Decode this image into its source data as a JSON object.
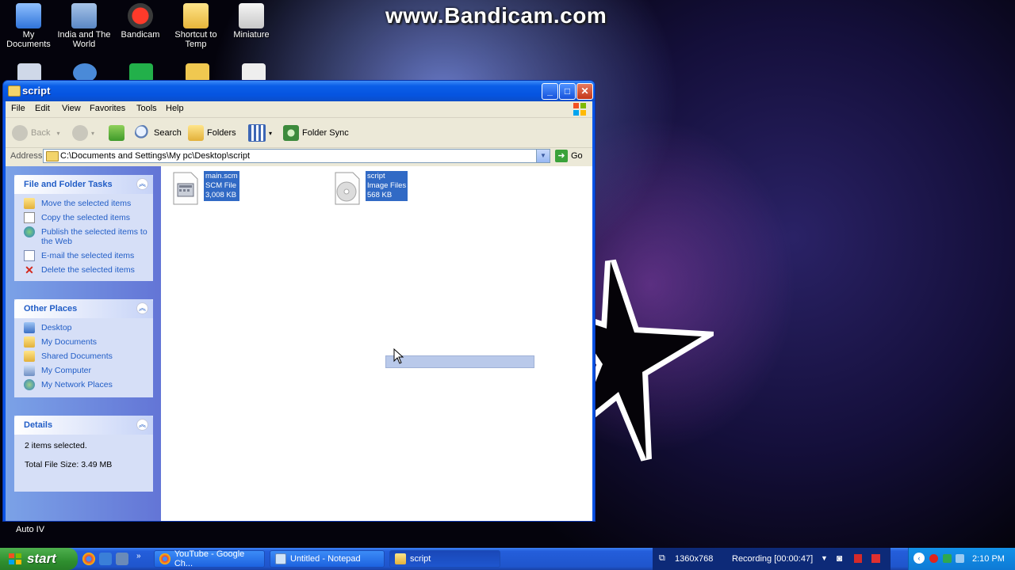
{
  "watermark": "www.Bandicam.com",
  "desktop": {
    "icons": [
      {
        "label": "My Documents"
      },
      {
        "label": "India and The World"
      },
      {
        "label": "Bandicam"
      },
      {
        "label": "Shortcut to Temp"
      },
      {
        "label": "Miniature"
      }
    ],
    "bottom_left_label": "Auto IV"
  },
  "window": {
    "title": "script",
    "menu": [
      "File",
      "Edit",
      "View",
      "Favorites",
      "Tools",
      "Help"
    ],
    "toolbar": {
      "back": "Back",
      "search": "Search",
      "folders": "Folders",
      "folder_sync": "Folder Sync"
    },
    "address": {
      "label": "Address",
      "path": "C:\\Documents and Settings\\My pc\\Desktop\\script",
      "go": "Go"
    },
    "file_tasks": {
      "title": "File and Folder Tasks",
      "items": [
        "Move the selected items",
        "Copy the selected items",
        "Publish the selected items to the Web",
        "E-mail the selected items",
        "Delete the selected items"
      ]
    },
    "other_places": {
      "title": "Other Places",
      "items": [
        "Desktop",
        "My Documents",
        "Shared Documents",
        "My Computer",
        "My Network Places"
      ]
    },
    "details": {
      "title": "Details",
      "selected": "2 items selected.",
      "total": "Total File Size: 3.49 MB"
    },
    "files": [
      {
        "name": "main.scm",
        "type": "SCM File",
        "size": "3,008 KB"
      },
      {
        "name": "script",
        "type": "Image Files",
        "size": "568 KB"
      }
    ]
  },
  "taskbar": {
    "start": "start",
    "buttons": [
      "YouTube - Google Ch...",
      "Untitled - Notepad",
      "script"
    ],
    "resolution": "1360x768",
    "recording": "Recording [00:00:47]",
    "clock": "2:10 PM"
  },
  "colors": {
    "selection": "#316ac5",
    "titlebar": "#0a5ee8",
    "taskpane_link": "#215dc6",
    "taskbar": "#245edb",
    "start_green": "#3c9a3c"
  }
}
